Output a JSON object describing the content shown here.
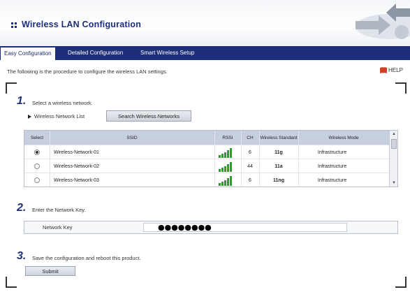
{
  "header": {
    "title": "Wireless LAN Configuration"
  },
  "tabs": [
    {
      "label": "Easy Configuration",
      "active": true
    },
    {
      "label": "Detailed Configuration",
      "active": false
    },
    {
      "label": "Smart Wireless Setup",
      "active": false
    }
  ],
  "intro_text": "The following is the procedure to configure the wireless LAN settings.",
  "help_label": "HELP",
  "steps": [
    {
      "number": "1.",
      "text": "Select a wireless network."
    },
    {
      "number": "2.",
      "text": "Enter the Network Key."
    },
    {
      "number": "3.",
      "text": "Save the configuration and reboot this product."
    }
  ],
  "network_list": {
    "label": "Wireless Network List",
    "search_button": "Search Wireless Networks",
    "columns": [
      "Select",
      "SSID",
      "RSSI",
      "CH",
      "Wireless Standard",
      "Wireless Mode"
    ],
    "rows": [
      {
        "selected": true,
        "ssid": "Wireless-Network-01",
        "rssi_bars": 5,
        "ch": "6",
        "standard": "11g",
        "mode": "Infrastructure"
      },
      {
        "selected": false,
        "ssid": "Wireless-Network-02",
        "rssi_bars": 5,
        "ch": "44",
        "standard": "11a",
        "mode": "Infrastructure"
      },
      {
        "selected": false,
        "ssid": "Wireless-Network-03",
        "rssi_bars": 5,
        "ch": "6",
        "standard": "11ng",
        "mode": "Infrastructure"
      }
    ]
  },
  "network_key": {
    "label": "Network Key",
    "value": "●●●●●●●●"
  },
  "submit_label": "Submit",
  "colors": {
    "navy": "#1e2e7a",
    "table_header": "#c5cfe0",
    "signal": "#2aa02a",
    "help_icon": "#d1402b"
  }
}
